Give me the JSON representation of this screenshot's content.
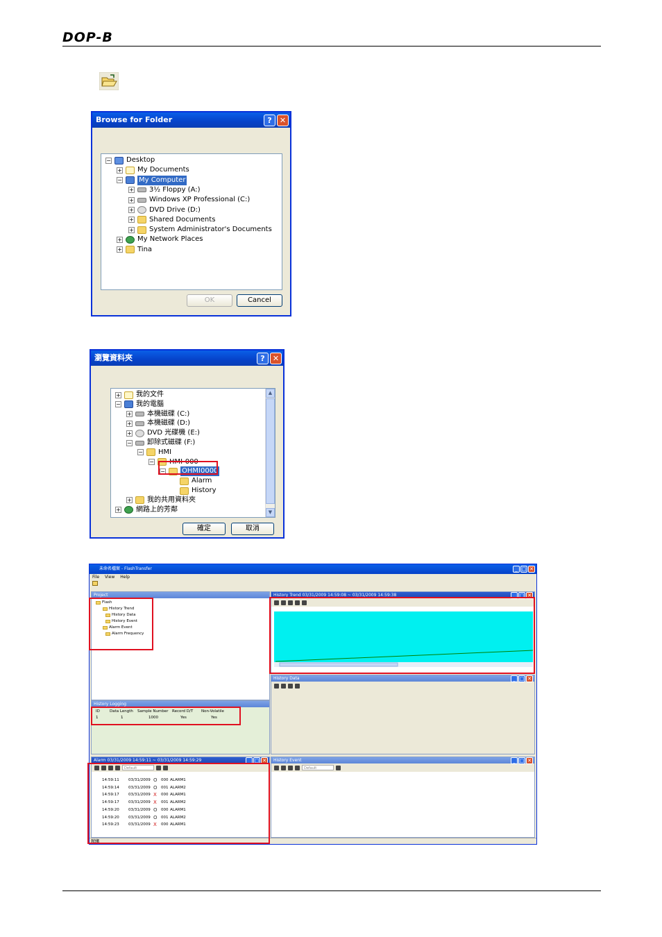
{
  "header": {
    "logo": "DOP-B"
  },
  "dialog_en": {
    "title": "Browse for Folder",
    "items": [
      {
        "label": "Desktop",
        "sign": "⊟",
        "icon": "desk"
      },
      {
        "label": "My Documents",
        "sign": "⊞",
        "icon": "doc"
      },
      {
        "label": "My Computer",
        "sign": "⊟",
        "icon": "pc",
        "selected": true
      },
      {
        "label": "3½ Floppy (A:)",
        "sign": "⊞",
        "icon": "drive"
      },
      {
        "label": "Windows XP Professional (C:)",
        "sign": "⊞",
        "icon": "drive"
      },
      {
        "label": "DVD Drive (D:)",
        "sign": "⊞",
        "icon": "cd"
      },
      {
        "label": "Shared Documents",
        "sign": "⊞",
        "icon": "folder"
      },
      {
        "label": "System Administrator's Documents",
        "sign": "⊞",
        "icon": "folder"
      },
      {
        "label": "My Network Places",
        "sign": "⊞",
        "icon": "net"
      },
      {
        "label": "Tina",
        "sign": "⊞",
        "icon": "folder"
      }
    ],
    "ok": "OK",
    "cancel": "Cancel"
  },
  "dialog_zh": {
    "title": "瀏覽資料夾",
    "items": [
      {
        "label": "我的文件",
        "sign": "⊞",
        "icon": "doc"
      },
      {
        "label": "我的電腦",
        "sign": "⊟",
        "icon": "pc"
      },
      {
        "label": "本機磁碟 (C:)",
        "sign": "⊞",
        "icon": "drive"
      },
      {
        "label": "本機磁碟 (D:)",
        "sign": "⊞",
        "icon": "drive"
      },
      {
        "label": "DVD 光碟機 (E:)",
        "sign": "⊞",
        "icon": "cd"
      },
      {
        "label": "卸除式磁碟 (F:)",
        "sign": "⊟",
        "icon": "drive"
      },
      {
        "label": "HMI",
        "sign": "⊟",
        "icon": "folder"
      },
      {
        "label": "HMI-000",
        "sign": "⊟",
        "icon": "folder"
      },
      {
        "label": "OHMI0000",
        "sign": "⊟",
        "icon": "folder",
        "selected": true
      },
      {
        "label": "Alarm",
        "sign": "",
        "icon": "folder"
      },
      {
        "label": "History",
        "sign": "",
        "icon": "folder"
      },
      {
        "label": "我的共用資料夾",
        "sign": "⊞",
        "icon": "folder"
      },
      {
        "label": "網路上的芳鄰",
        "sign": "⊞",
        "icon": "net"
      }
    ],
    "ok": "確定",
    "cancel": "取消"
  },
  "app": {
    "title": "未命名檔案 - FlashTransfer",
    "menu": [
      "File",
      "View",
      "Help"
    ],
    "project_title": "Project",
    "project_tree": [
      {
        "label": "Flash"
      },
      {
        "label": "History Trend"
      },
      {
        "label": "History Data"
      },
      {
        "label": "History Event"
      },
      {
        "label": "Alarm Event"
      },
      {
        "label": "Alarm Frequency"
      }
    ],
    "trend_title": "History Trend 03/31/2009 14:59:08 ~ 03/31/2009 14:59:38",
    "history_data_title": "History Data",
    "logging_title": "History Logging",
    "logging_headers": [
      "ID",
      "Data Length",
      "Sample Number",
      "Record D/T",
      "Non-Volatile"
    ],
    "logging_row": [
      "1",
      "1",
      "1000",
      "Yes",
      "Yes"
    ],
    "alarm_title": "Alarm 03/31/2009 14:59:11 ~ 03/31/2009 14:59:29",
    "alarm_dropdown": "Default",
    "alarm_rows": [
      {
        "time": "14:59:11",
        "date": "03/31/2009",
        "mark": "O",
        "code": "000",
        "name": "ALARM1"
      },
      {
        "time": "14:59:14",
        "date": "03/31/2009",
        "mark": "O",
        "code": "001",
        "name": "ALARM2"
      },
      {
        "time": "14:59:17",
        "date": "03/31/2009",
        "mark": "X",
        "code": "000",
        "name": "ALARM1"
      },
      {
        "time": "14:59:17",
        "date": "03/31/2009",
        "mark": "X",
        "code": "001",
        "name": "ALARM2"
      },
      {
        "time": "14:59:20",
        "date": "03/31/2009",
        "mark": "O",
        "code": "000",
        "name": "ALARM1"
      },
      {
        "time": "14:59:20",
        "date": "03/31/2009",
        "mark": "O",
        "code": "001",
        "name": "ALARM2"
      },
      {
        "time": "14:59:23",
        "date": "03/31/2009",
        "mark": "X",
        "code": "000",
        "name": "ALARM1"
      }
    ],
    "event_title": "History Event",
    "event_dropdown": "Default",
    "status": "就緒"
  },
  "colors": {
    "trend_bg": "#00f0f0",
    "trend_line": "#008000",
    "highlight": "#e01020"
  }
}
